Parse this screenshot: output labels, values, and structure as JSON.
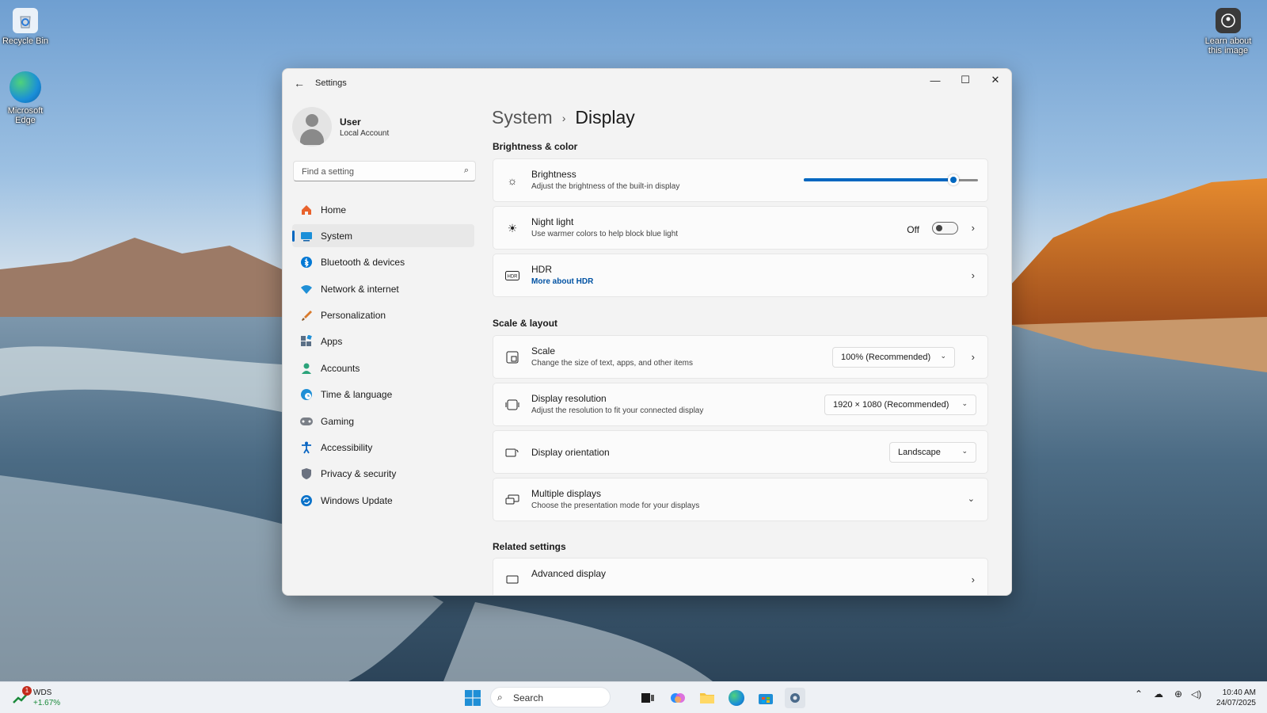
{
  "desktop": {
    "icons": [
      {
        "label": "Recycle Bin"
      },
      {
        "label": "Microsoft Edge"
      },
      {
        "label": "Learn about this image"
      }
    ]
  },
  "window": {
    "title": "Settings",
    "controls": {
      "minimize": "—",
      "maximize": "☐",
      "close": "✕"
    }
  },
  "profile": {
    "name": "User",
    "account": "Local Account"
  },
  "search": {
    "placeholder": "Find a setting"
  },
  "nav": {
    "items": [
      {
        "label": "Home",
        "icon": "home-icon",
        "color": "#e8622c"
      },
      {
        "label": "System",
        "icon": "system-icon",
        "color": "#0067c0",
        "active": true
      },
      {
        "label": "Bluetooth & devices",
        "icon": "bluetooth-icon",
        "color": "#0078d4"
      },
      {
        "label": "Network & internet",
        "icon": "wifi-icon",
        "color": "#1f8fd6"
      },
      {
        "label": "Personalization",
        "icon": "brush-icon",
        "color": "#d97a2b"
      },
      {
        "label": "Apps",
        "icon": "apps-icon",
        "color": "#5a6f86"
      },
      {
        "label": "Accounts",
        "icon": "accounts-icon",
        "color": "#2ba37a"
      },
      {
        "label": "Time & language",
        "icon": "globe-clock-icon",
        "color": "#1f8fd6"
      },
      {
        "label": "Gaming",
        "icon": "gamepad-icon",
        "color": "#7a7f87"
      },
      {
        "label": "Accessibility",
        "icon": "accessibility-icon",
        "color": "#0a66c2"
      },
      {
        "label": "Privacy & security",
        "icon": "shield-icon",
        "color": "#6b7280"
      },
      {
        "label": "Windows Update",
        "icon": "update-icon",
        "color": "#0a72c9"
      }
    ]
  },
  "main": {
    "breadcrumb": {
      "parent": "System",
      "separator": "›",
      "current": "Display"
    },
    "sections": {
      "brightness_color": "Brightness & color",
      "scale_layout": "Scale & layout",
      "related": "Related settings"
    },
    "brightness": {
      "title": "Brightness",
      "subtitle": "Adjust the brightness of the built-in display",
      "value": 0.86
    },
    "night_light": {
      "title": "Night light",
      "subtitle": "Use warmer colors to help block blue light",
      "state": "Off"
    },
    "hdr": {
      "title": "HDR",
      "link": "More about HDR"
    },
    "scale": {
      "title": "Scale",
      "subtitle": "Change the size of text, apps, and other items",
      "value": "100% (Recommended)"
    },
    "resolution": {
      "title": "Display resolution",
      "subtitle": "Adjust the resolution to fit your connected display",
      "value": "1920 × 1080 (Recommended)"
    },
    "orientation": {
      "title": "Display orientation",
      "value": "Landscape"
    },
    "multiple": {
      "title": "Multiple displays",
      "subtitle": "Choose the presentation mode for your displays"
    },
    "advanced": {
      "title": "Advanced display"
    }
  },
  "taskbar": {
    "stock": {
      "name": "WDS",
      "change": "+1.67%",
      "badge": "1"
    },
    "search_placeholder": "Search",
    "clock": {
      "time": "10:40 AM",
      "date": "24/07/2025"
    },
    "accent": "#0067c0"
  }
}
